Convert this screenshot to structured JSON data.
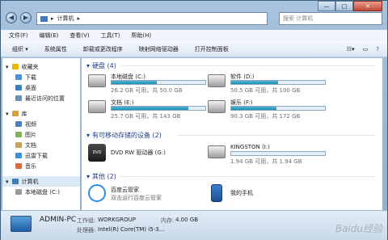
{
  "window": {
    "controls": {
      "minimize": "—",
      "maximize": "□",
      "close": "✕"
    }
  },
  "address": {
    "back": "◀",
    "forward": "▶",
    "path": [
      "计算机"
    ],
    "search_placeholder": "搜索 计算机"
  },
  "menu": [
    "文件(F)",
    "编辑(E)",
    "查看(V)",
    "工具(T)",
    "帮助(H)"
  ],
  "toolbar": {
    "items": [
      "组织 ▾",
      "系统属性",
      "卸载或更改程序",
      "映射网络驱动器",
      "打开控制面板"
    ]
  },
  "nav": {
    "items": [
      {
        "label": "收藏夹",
        "icon": "star-icon",
        "color": "#e6b800"
      },
      {
        "label": "下载",
        "icon": "download-folder-icon",
        "color": "#4a90d9"
      },
      {
        "label": "桌面",
        "icon": "desktop-icon",
        "color": "#3a7ec4"
      },
      {
        "label": "最近访问的位置",
        "icon": "recent-places-icon",
        "color": "#6c8fb5"
      },
      {
        "label": "库",
        "icon": "library-icon",
        "color": "#d9a040"
      },
      {
        "label": "视频",
        "icon": "video-icon",
        "color": "#4d7fc0"
      },
      {
        "label": "图片",
        "icon": "pictures-icon",
        "color": "#7fb05a"
      },
      {
        "label": "文档",
        "icon": "documents-icon",
        "color": "#c7a360"
      },
      {
        "label": "迅雷下载",
        "icon": "thunder-download-icon",
        "color": "#3d8fd8"
      },
      {
        "label": "音乐",
        "icon": "music-icon",
        "color": "#d96a3a"
      },
      {
        "label": "计算机",
        "icon": "computer-icon",
        "color": "#4479b8"
      },
      {
        "label": "本地磁盘 (C:)",
        "icon": "drive-icon",
        "color": "#9a9a9a"
      }
    ]
  },
  "groups": {
    "hdd": "硬盘 (4)",
    "removable": "有可移动存储的设备 (2)",
    "other": "其他 (2)"
  },
  "drives": [
    {
      "name": "本地磁盘 (C:)",
      "info": "26.2 GB 可用，共 50.0 GB",
      "used_fraction": 0.48
    },
    {
      "name": "软件 (D:)",
      "info": "50.5 GB 可用，共 100 GB",
      "used_fraction": 0.5
    },
    {
      "name": "文档 (E:)",
      "info": "25.7 GB 可用，共 143 GB",
      "used_fraction": 0.82
    },
    {
      "name": "娱乐 (F:)",
      "info": "90.3 GB 可用，共 172 GB",
      "used_fraction": 0.48
    }
  ],
  "removable": [
    {
      "name": "DVD RW 驱动器 (G:)",
      "info": ""
    },
    {
      "name": "KINGSTON (I:)",
      "info": "1.94 GB 可用，共 1.94 GB",
      "used_fraction": 0.0
    }
  ],
  "other": [
    {
      "name": "百度云管家",
      "sub": "双击运行百度云管家"
    },
    {
      "name": "我的手机",
      "sub": ""
    }
  ],
  "details": {
    "pc_name": "ADMIN-PC",
    "workgroup_label": "工作组:",
    "workgroup": "WORKGROUP",
    "memory_label": "内存:",
    "memory": "4.00 GB",
    "cpu_label": "处理器:",
    "cpu": "Intel(R) Core(TM) i5-3..."
  },
  "watermark": "Baidu经验"
}
